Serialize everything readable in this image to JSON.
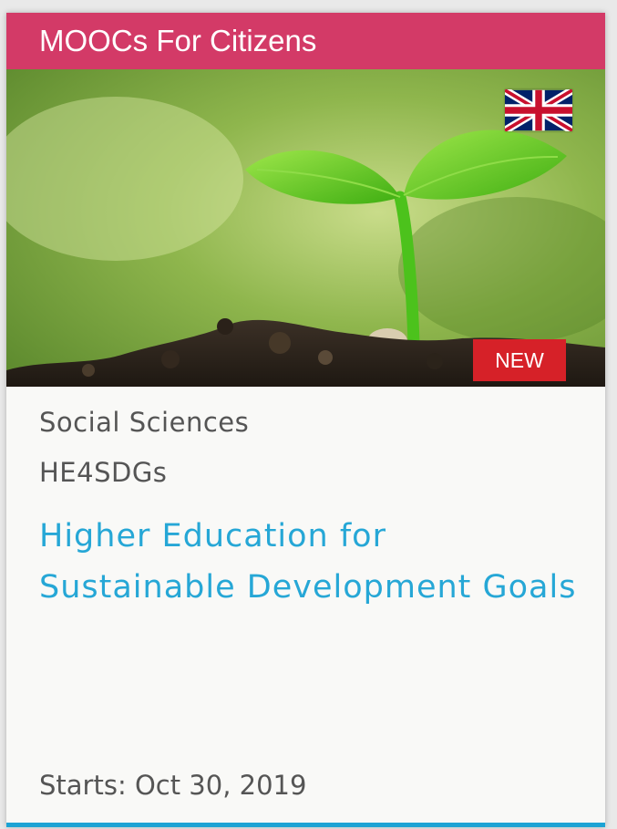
{
  "card": {
    "category": "MOOCs For Citizens",
    "badge": "NEW",
    "language_flag_icon": "uk-flag-icon",
    "subject": "Social Sciences",
    "code": "HE4SDGs",
    "title": "Higher Education for Sustainable Development Goals",
    "start_date": "Starts: Oct 30, 2019"
  },
  "colors": {
    "banner": "#d33a67",
    "title": "#26a7d6",
    "badge": "#d62128",
    "bottom_bar": "#1ca3d4",
    "meta_text": "#555555"
  }
}
